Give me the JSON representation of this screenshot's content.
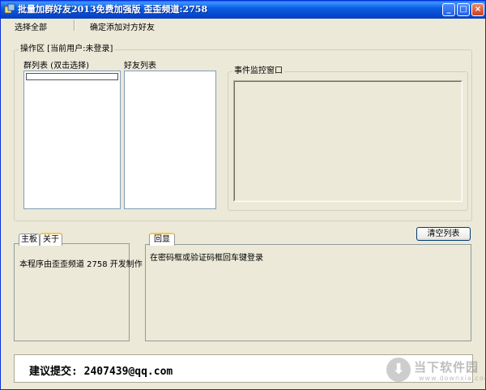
{
  "window": {
    "title": "批量加群好友2013免费加强版  歪歪频道:2758",
    "controls": {
      "minimize": "_",
      "maximize": "□",
      "close": "×"
    }
  },
  "menu": {
    "items": [
      "选择全部",
      "确定添加对方好友"
    ]
  },
  "operations": {
    "caption": "操作区 [当前用户:未登录]",
    "group_list_label": "群列表 (双击选择)",
    "friend_list_label": "好友列表",
    "monitor_caption": "事件监控窗口"
  },
  "left_tabs": {
    "tabs": [
      "主板",
      "关于"
    ],
    "active": 1,
    "content": "本程序由歪歪频道 2758 开发制作"
  },
  "right_tabs": {
    "tabs": [
      "回显"
    ],
    "content": "在密码框或验证码框回车键登录",
    "clear_button": "清空列表"
  },
  "footer": {
    "text": "建议提交: 2407439@qq.com"
  },
  "watermark": {
    "name": "当下软件园",
    "url": "www.downxia.com",
    "icon": "download-arrow-icon"
  }
}
